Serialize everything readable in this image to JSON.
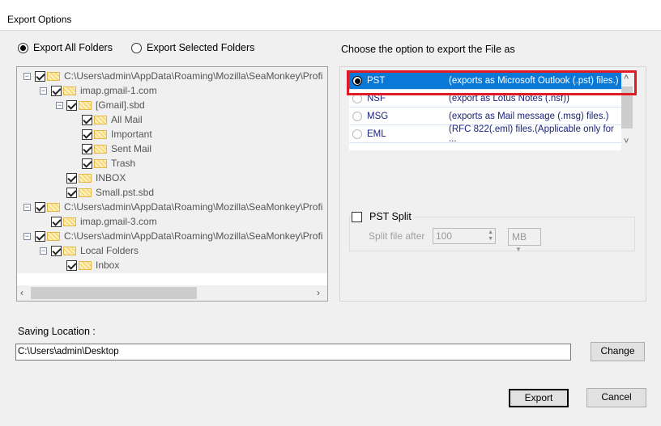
{
  "window": {
    "title": "Export Options"
  },
  "scope": {
    "options": [
      {
        "label": "Export All Folders",
        "selected": true
      },
      {
        "label": "Export Selected Folders",
        "selected": false
      }
    ]
  },
  "tree": [
    {
      "label": "C:\\Users\\admin\\AppData\\Roaming\\Mozilla\\SeaMonkey\\Profi",
      "level": 0,
      "expander": true,
      "checked": true
    },
    {
      "label": "imap.gmail-1.com",
      "level": 1,
      "expander": true,
      "checked": true
    },
    {
      "label": "[Gmail].sbd",
      "level": 2,
      "expander": true,
      "checked": true
    },
    {
      "label": "All Mail",
      "level": 3,
      "expander": false,
      "checked": true
    },
    {
      "label": "Important",
      "level": 3,
      "expander": false,
      "checked": true
    },
    {
      "label": "Sent Mail",
      "level": 3,
      "expander": false,
      "checked": true
    },
    {
      "label": "Trash",
      "level": 3,
      "expander": false,
      "checked": true
    },
    {
      "label": "INBOX",
      "level": 2,
      "expander": false,
      "checked": true
    },
    {
      "label": "Small.pst.sbd",
      "level": 2,
      "expander": false,
      "checked": true
    },
    {
      "label": "C:\\Users\\admin\\AppData\\Roaming\\Mozilla\\SeaMonkey\\Profi",
      "level": 0,
      "expander": true,
      "checked": true
    },
    {
      "label": "imap.gmail-3.com",
      "level": 1,
      "expander": false,
      "checked": true
    },
    {
      "label": "C:\\Users\\admin\\AppData\\Roaming\\Mozilla\\SeaMonkey\\Profi",
      "level": 0,
      "expander": true,
      "checked": true
    },
    {
      "label": "Local Folders",
      "level": 1,
      "expander": true,
      "checked": true
    },
    {
      "label": "Inbox",
      "level": 2,
      "expander": false,
      "checked": true
    }
  ],
  "formats": {
    "heading": "Choose the option to export the File as",
    "items": [
      {
        "name": "PST",
        "desc": "(exports as Microsoft Outlook (.pst) files.)",
        "selected": true
      },
      {
        "name": "NSF",
        "desc": "(export as Lotus Notes (.nsf))",
        "selected": false
      },
      {
        "name": "MSG",
        "desc": "(exports as Mail message (.msg) files.)",
        "selected": false
      },
      {
        "name": "EML",
        "desc": "(RFC 822(.eml) files.(Applicable only for ...",
        "selected": false
      }
    ]
  },
  "split": {
    "label": "PST Split",
    "checked": false,
    "after_label": "Split file after",
    "value": "100",
    "unit": "MB"
  },
  "saving": {
    "label": "Saving Location :",
    "path": "C:\\Users\\admin\\Desktop",
    "change": "Change"
  },
  "buttons": {
    "export": "Export",
    "cancel": "Cancel"
  },
  "colors": {
    "selection": "#0a78d7",
    "highlight": "#e01b24"
  }
}
